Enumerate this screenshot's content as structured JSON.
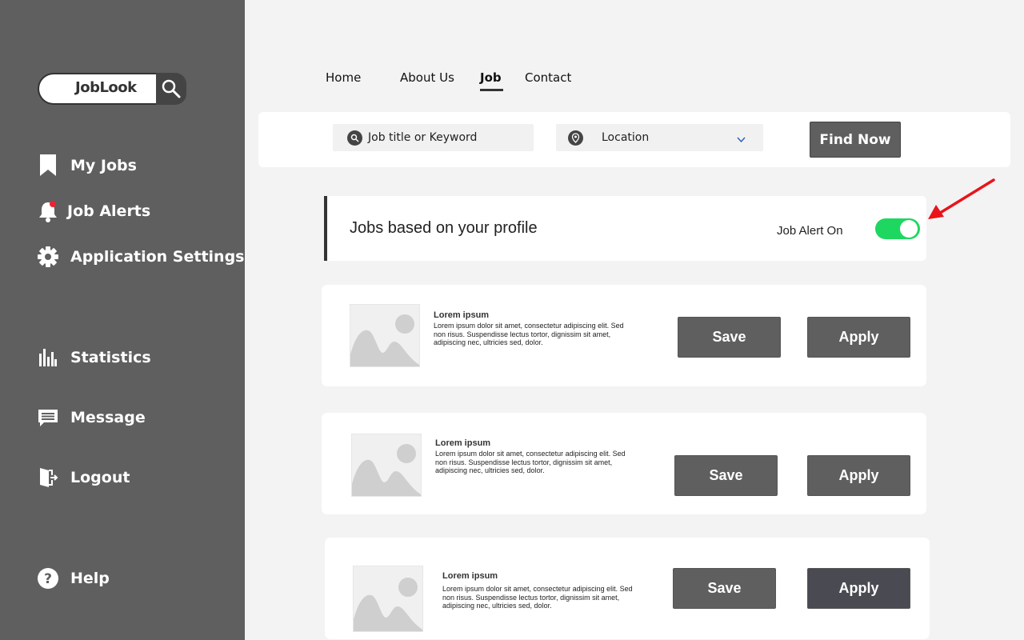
{
  "sidebar": {
    "logo": "JobLook",
    "items": [
      {
        "label": "My Jobs",
        "icon": "bookmark-icon"
      },
      {
        "label": "Job Alerts",
        "icon": "bell-icon"
      },
      {
        "label": "Application Settings",
        "icon": "gear-icon"
      },
      {
        "label": "Statistics",
        "icon": "bar-chart-icon"
      },
      {
        "label": "Message",
        "icon": "message-icon"
      },
      {
        "label": "Logout",
        "icon": "logout-icon"
      },
      {
        "label": "Help",
        "icon": "help-icon"
      }
    ]
  },
  "topnav": {
    "items": [
      "Home",
      "About Us",
      "Job",
      "Contact"
    ],
    "active": "Job"
  },
  "search": {
    "keyword_placeholder": "Job title or Keyword",
    "location_placeholder": "Location",
    "find_label": "Find Now"
  },
  "banner": {
    "title": "Jobs based on your profile",
    "alert_label": "Job Alert On",
    "alert_on": true
  },
  "jobs": [
    {
      "title": "Lorem ipsum",
      "description": "Lorem ipsum dolor sit amet, consectetur adipiscing elit. Sed non risus. Suspendisse lectus tortor, dignissim sit amet, adipiscing nec, ultricies sed, dolor.",
      "save_label": "Save",
      "apply_label": "Apply"
    },
    {
      "title": "Lorem ipsum",
      "description": "Lorem ipsum dolor sit amet, consectetur adipiscing elit. Sed non risus. Suspendisse lectus tortor, dignissim sit amet, adipiscing nec, ultricies sed, dolor.",
      "save_label": "Save",
      "apply_label": "Apply"
    },
    {
      "title": "Lorem ipsum",
      "description": "Lorem ipsum dolor sit amet, consectetur adipiscing elit. Sed non risus. Suspendisse lectus tortor, dignissim sit amet, adipiscing nec, ultricies sed, dolor.",
      "save_label": "Save",
      "apply_label": "Apply"
    }
  ],
  "colors": {
    "sidebar": "#5f5f5f",
    "toggle_on": "#1ed760",
    "annotation_arrow": "#e8141a",
    "button": "#5f5f5f"
  }
}
